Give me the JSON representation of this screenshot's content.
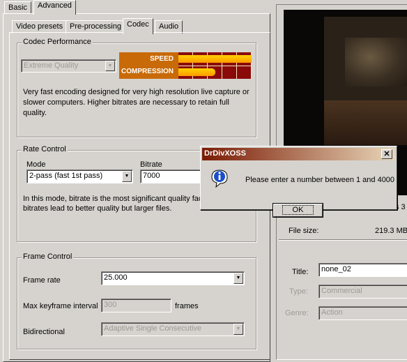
{
  "top_tabs": {
    "basic": "Basic",
    "advanced": "Advanced"
  },
  "sub_tabs": {
    "video_presets": "Video presets",
    "pre_processing": "Pre-processing",
    "codec": "Codec",
    "audio": "Audio"
  },
  "codec_performance": {
    "title": "Codec Performance",
    "quality_select": "Extreme Quality",
    "speed_label": "SPEED",
    "compression_label": "COMPRESSION",
    "speed_level": 1.0,
    "compression_level": 0.5,
    "meter_color": "#c86a08",
    "grid_color": "#8a0a0a",
    "bar_color": "#ffd200",
    "description": "Very fast encoding designed for very high resolution live capture or slower computers. Higher bitrates are necessary to retain full quality."
  },
  "rate_control": {
    "title": "Rate Control",
    "mode_label": "Mode",
    "mode_value": "2-pass (fast 1st pass)",
    "bitrate_label": "Bitrate",
    "bitrate_value": "7000",
    "desc_line1": "In this mode, bitrate is the most significant quality fac",
    "desc_line2": "bitrates lead to better quality but larger files."
  },
  "frame_control": {
    "title": "Frame Control",
    "frame_rate_label": "Frame rate",
    "frame_rate_value": "25.000",
    "max_keyframe_label": "Max keyframe interval",
    "max_keyframe_value": "300",
    "frames_label": "frames",
    "bidirectional_label": "Bidirectional",
    "bidirectional_value": "Adaptive Single Consecutive"
  },
  "right_panel": {
    "duration_partial": "s 3",
    "file_size_label": "File size:",
    "file_size_value": "219.3 MB",
    "title_label": "Title:",
    "title_value": "none_02",
    "type_label": "Type:",
    "type_value": "Commercial",
    "genre_label": "Genre:",
    "genre_value": "Action"
  },
  "dialog": {
    "title": "DrDivXOSS",
    "message": "Please enter a number between 1 and 4000",
    "ok_label": "OK",
    "titlebar_color_start": "#7a1a04",
    "titlebar_color_end": "#e8d6b8"
  }
}
